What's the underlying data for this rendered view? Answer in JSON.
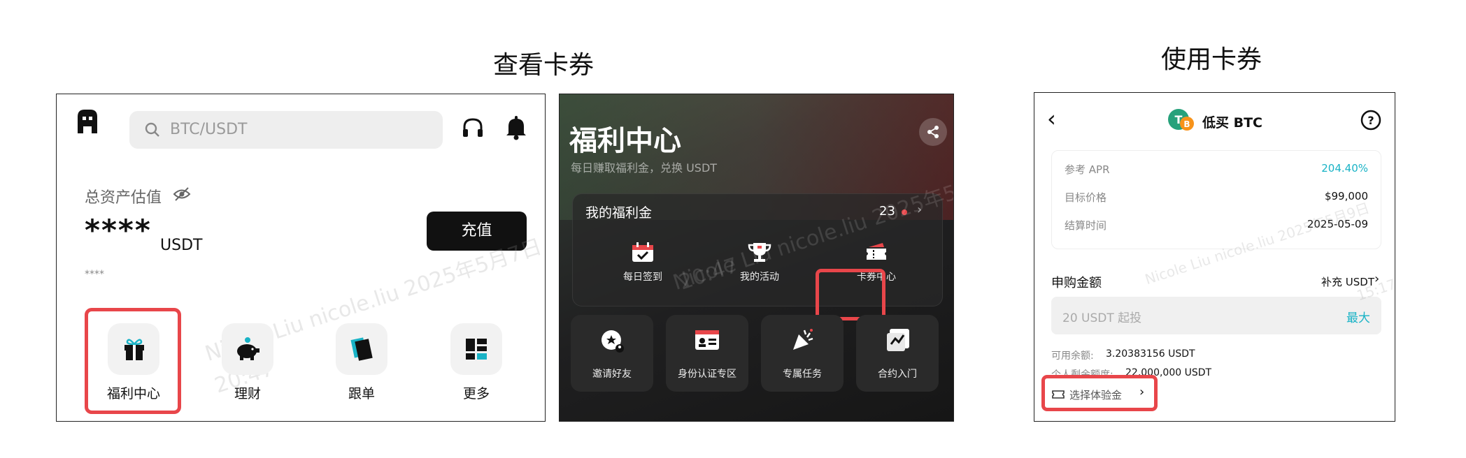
{
  "headings": {
    "view_coupons": "查看卡券",
    "use_coupons": "使用卡券"
  },
  "home": {
    "search_placeholder": "BTC/USDT",
    "total_assets_label": "总资产估值",
    "balance_masked": "****",
    "currency": "USDT",
    "sub_masked": "****",
    "deposit_button": "充值",
    "shortcuts": [
      {
        "label": "福利中心",
        "icon": "gift-icon"
      },
      {
        "label": "理财",
        "icon": "piggy-bank-icon"
      },
      {
        "label": "跟单",
        "icon": "copy-trade-icon"
      },
      {
        "label": "更多",
        "icon": "grid-more-icon"
      }
    ],
    "watermark": "Nicole Liu nicole.liu 2025年5月7日",
    "watermark_time": "20:47"
  },
  "welfare": {
    "title": "福利中心",
    "subtitle": "每日赚取福利金，兑换 USDT",
    "my_bonus_label": "我的福利金",
    "bonus_count": "23",
    "actions": [
      {
        "label": "每日签到",
        "icon": "calendar-check-icon"
      },
      {
        "label": "我的活动",
        "icon": "trophy-icon"
      },
      {
        "label": "卡券中心",
        "icon": "ticket-icon"
      }
    ],
    "tiles": [
      {
        "label": "邀请好友",
        "icon": "invite-icon"
      },
      {
        "label": "身份认证专区",
        "icon": "id-card-icon"
      },
      {
        "label": "专属任务",
        "icon": "party-popper-icon"
      },
      {
        "label": "合约入门",
        "icon": "chart-icon"
      }
    ],
    "watermark": "Nicole Liu nicole.liu 2025年5月7日",
    "watermark_time": "20:47"
  },
  "buy_low": {
    "title": "低买 BTC",
    "rows": [
      {
        "key": "参考 APR",
        "value": "204.40%"
      },
      {
        "key": "目标价格",
        "value": "$99,000"
      },
      {
        "key": "结算时间",
        "value": "2025-05-09"
      }
    ],
    "subscribe_label": "申购金额",
    "top_up_label": "补充 USDT",
    "amount_placeholder": "20 USDT 起投",
    "max_label": "最大",
    "available_label": "可用余额:",
    "available_value": "3.20383156 USDT",
    "limit_label": "个人剩余额度:",
    "limit_value": "22,000,000 USDT",
    "trial_bonus_label": "选择体验金",
    "watermark": "Nicole Liu nicole.liu 2025年5月9日",
    "watermark_time": "15:17"
  },
  "colors": {
    "highlight_red": "#e8464a",
    "accent_cyan": "#19b3c6",
    "deposit_bg": "#111111"
  }
}
